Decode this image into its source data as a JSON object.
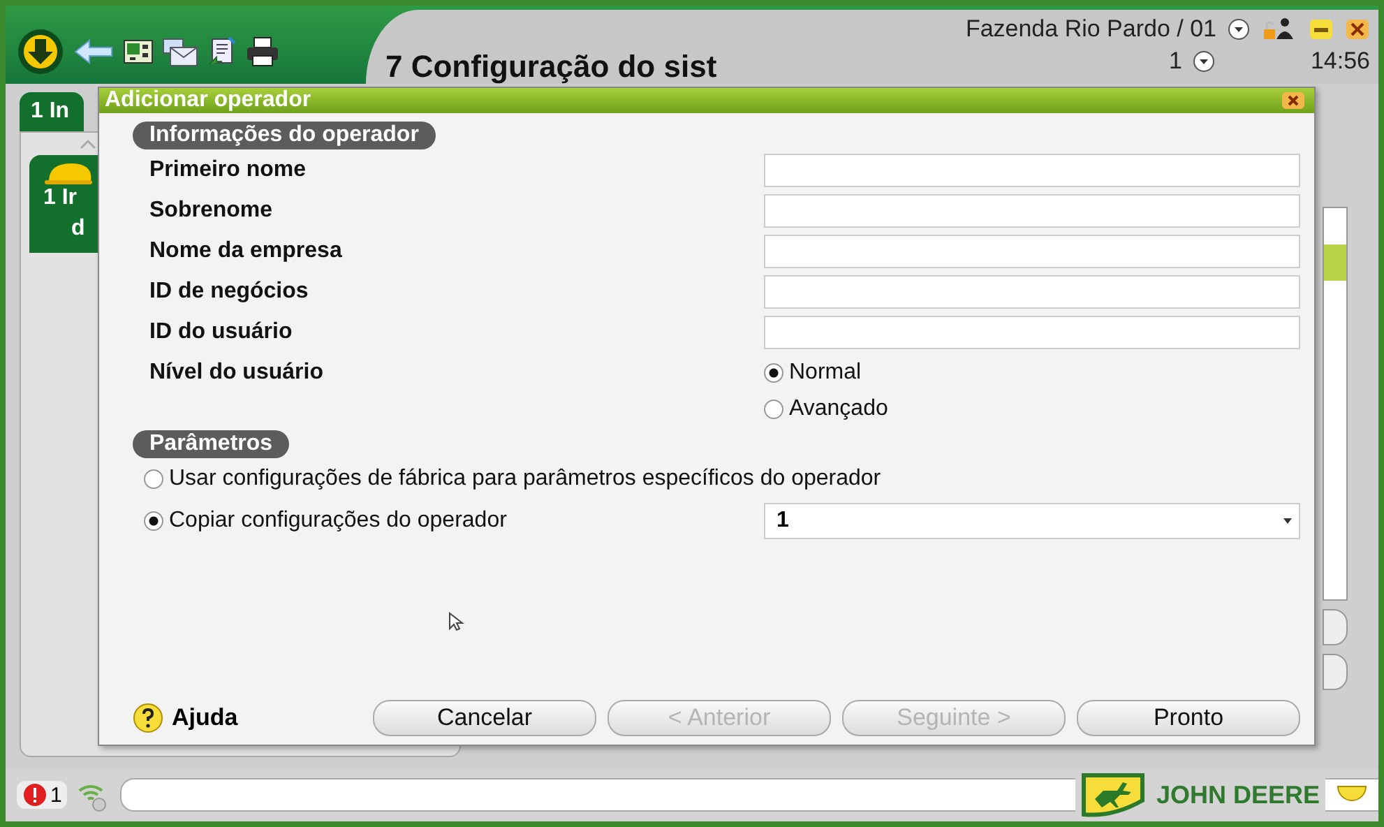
{
  "header": {
    "title": "7 Configuração do sist",
    "farm": "Fazenda Rio Pardo / 01",
    "number": "1",
    "time": "14:56"
  },
  "background": {
    "tab": "1 In",
    "item_lines": [
      "1 Ir",
      "d"
    ]
  },
  "dialog": {
    "title": "Adicionar operador",
    "sections": [
      {
        "title": "Informações do operador"
      },
      {
        "title": "Parâmetros"
      }
    ],
    "fields": [
      {
        "label": "Primeiro nome"
      },
      {
        "label": "Sobrenome"
      },
      {
        "label": "Nome da empresa"
      },
      {
        "label": "ID de negócios"
      },
      {
        "label": "ID do usuário"
      }
    ],
    "user_level": {
      "label": "Nível do usuário",
      "options": [
        {
          "label": "Normal",
          "selected": true
        },
        {
          "label": "Avançado",
          "selected": false
        }
      ]
    },
    "parameters": [
      {
        "label": "Usar configurações de fábrica para parâmetros específicos do operador",
        "selected": false
      },
      {
        "label": "Copiar configurações do operador",
        "selected": true,
        "dropdown": "1"
      }
    ],
    "help": "Ajuda",
    "buttons": [
      {
        "label": "Cancelar",
        "disabled": false
      },
      {
        "label": "< Anterior",
        "disabled": true
      },
      {
        "label": "Seguinte >",
        "disabled": true
      },
      {
        "label": "Pronto",
        "disabled": false
      }
    ]
  },
  "status_bar": {
    "alerts": "1",
    "logo": "JOHN DEERE"
  }
}
